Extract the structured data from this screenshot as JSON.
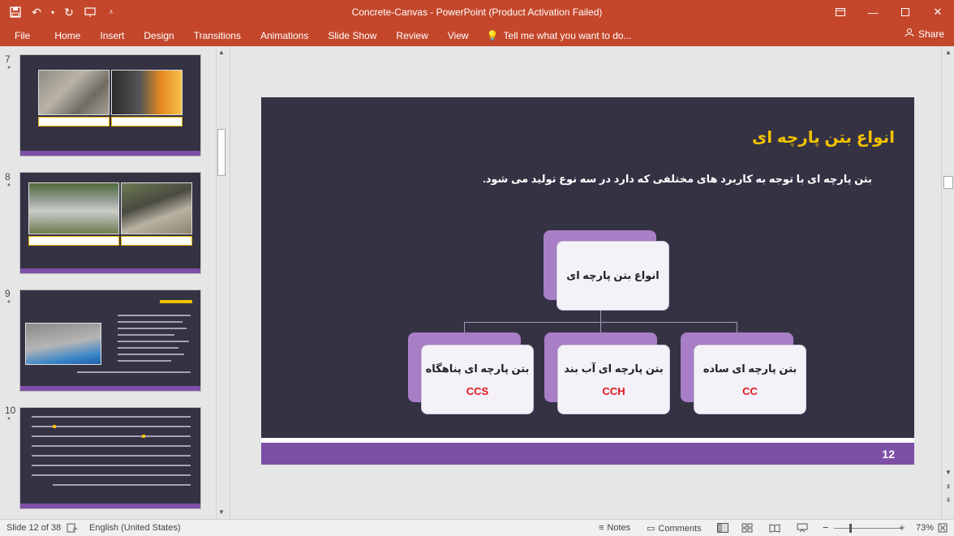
{
  "window": {
    "title": "Concrete-Canvas - PowerPoint (Product Activation Failed)",
    "quick_access": [
      "save-icon",
      "undo-icon",
      "redo-icon",
      "present-icon",
      "customize-icon"
    ]
  },
  "ribbon": {
    "tabs": [
      "File",
      "Home",
      "Insert",
      "Design",
      "Transitions",
      "Animations",
      "Slide Show",
      "Review",
      "View"
    ],
    "tell_me": "Tell me what you want to do...",
    "share": "Share"
  },
  "thumbnails": [
    {
      "number": "7",
      "star": "*"
    },
    {
      "number": "8",
      "star": "*"
    },
    {
      "number": "9",
      "star": "*"
    },
    {
      "number": "10",
      "star": "*"
    }
  ],
  "slide": {
    "title": "انواع بتن پارچه ای",
    "body": "بتن پارچه ای با توجه به کاربرد های مختلفی که دارد در سه نوع تولید می شود.",
    "number": "12",
    "root": {
      "label": "انواع بتن پارچه ای"
    },
    "children": [
      {
        "label": "بتن پارچه ای پناهگاه",
        "code": "CCS"
      },
      {
        "label": "بتن پارچه ای آب بند",
        "code": "CCH"
      },
      {
        "label": "بتن پارچه ای ساده",
        "code": "CC"
      }
    ]
  },
  "status": {
    "slide_info": "Slide 12 of 38",
    "language": "English (United States)",
    "notes": "Notes",
    "comments": "Comments",
    "zoom": "73%"
  },
  "colors": {
    "ribbon": "#c4472b",
    "slide_bg": "#353244",
    "accent_purple": "#7d4fa6",
    "title_yellow": "#f2c200",
    "code_red": "#e0161b"
  }
}
